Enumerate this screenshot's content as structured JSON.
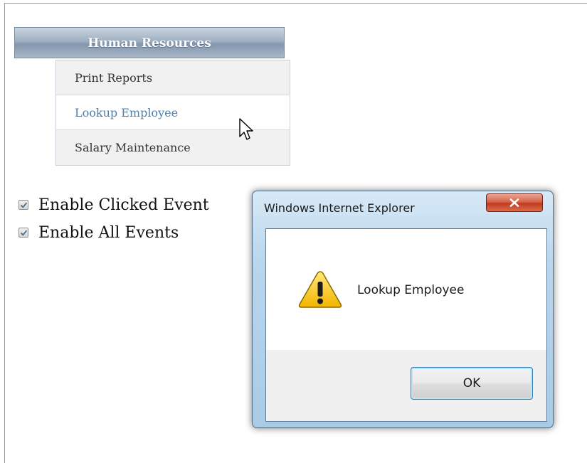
{
  "menu": {
    "header": "Human Resources",
    "items": [
      {
        "label": "Print Reports"
      },
      {
        "label": "Lookup Employee"
      },
      {
        "label": "Salary Maintenance"
      }
    ]
  },
  "options": [
    {
      "label": "Enable Clicked Event",
      "checked": true
    },
    {
      "label": "Enable All Events",
      "checked": true
    }
  ],
  "dialog": {
    "title": "Windows Internet Explorer",
    "message": "Lookup Employee",
    "ok_label": "OK",
    "icon": "warning-icon"
  },
  "colors": {
    "menu_header_bg": "#9fb0c2",
    "menu_hover_text": "#4a7fb0",
    "close_button": "#c23b1f",
    "ok_focus_border": "#3c7fb1"
  }
}
